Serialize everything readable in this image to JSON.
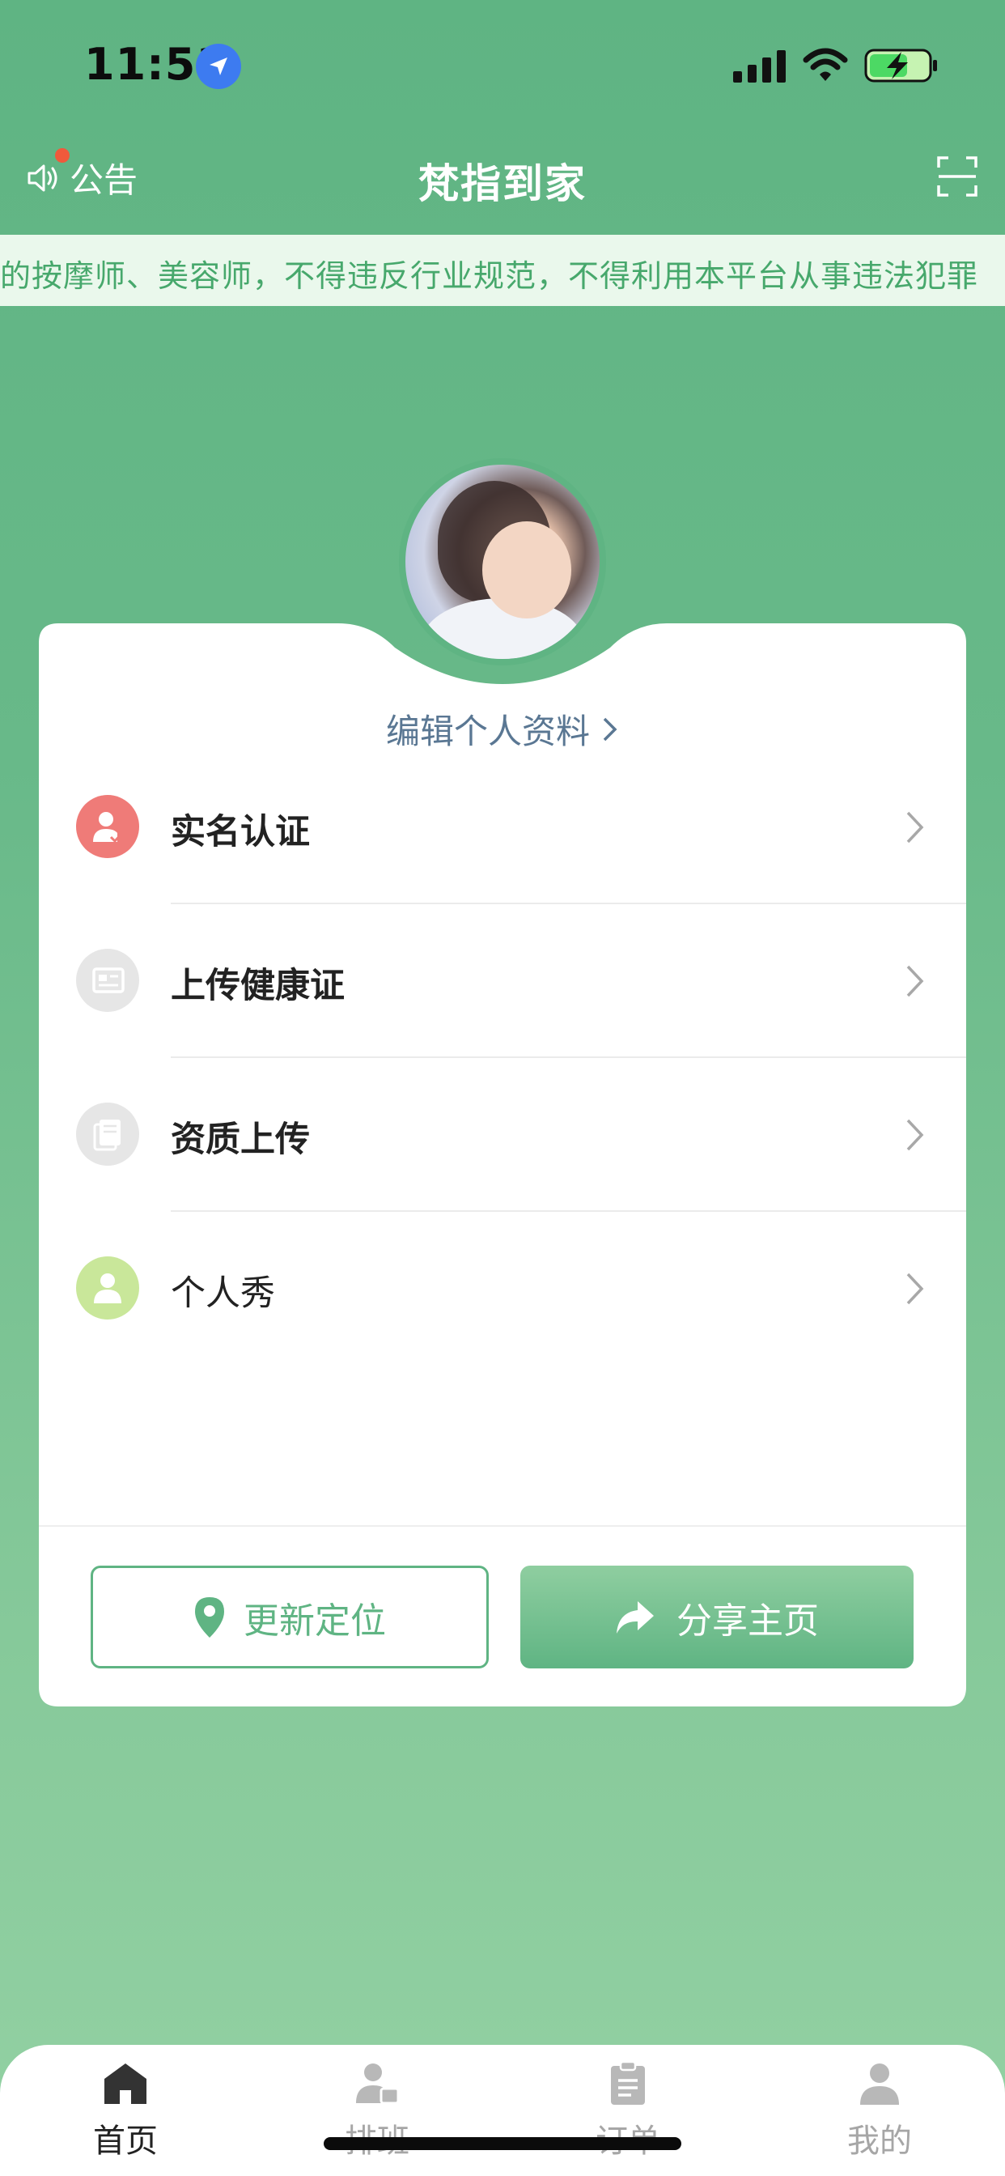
{
  "status_bar": {
    "time": "11:51"
  },
  "nav": {
    "announcement_label": "公告",
    "title": "梵指到家"
  },
  "marquee": {
    "text": "的按摩师、美容师，不得违反行业规范，不得利用本平台从事违法犯罪"
  },
  "profile": {
    "edit_label": "编辑个人资料"
  },
  "menu": [
    {
      "label": "实名认证",
      "icon": "id-verify-icon",
      "color": "#ef7b78"
    },
    {
      "label": "上传健康证",
      "icon": "card-icon",
      "color": "#e6e6e6"
    },
    {
      "label": "资质上传",
      "icon": "document-icon",
      "color": "#e6e6e6"
    },
    {
      "label": "个人秀",
      "icon": "user-icon",
      "color": "#c9e79a"
    }
  ],
  "actions": {
    "update_location": "更新定位",
    "share_homepage": "分享主页"
  },
  "tabs": [
    {
      "label": "首页",
      "icon": "home-icon",
      "active": true
    },
    {
      "label": "排班",
      "icon": "schedule-icon",
      "active": false
    },
    {
      "label": "订单",
      "icon": "clipboard-icon",
      "active": false
    },
    {
      "label": "我的",
      "icon": "profile-icon",
      "active": false
    }
  ],
  "colors": {
    "brand": "#5fb483",
    "accent_red": "#f05a3b",
    "link": "#5a7793"
  }
}
